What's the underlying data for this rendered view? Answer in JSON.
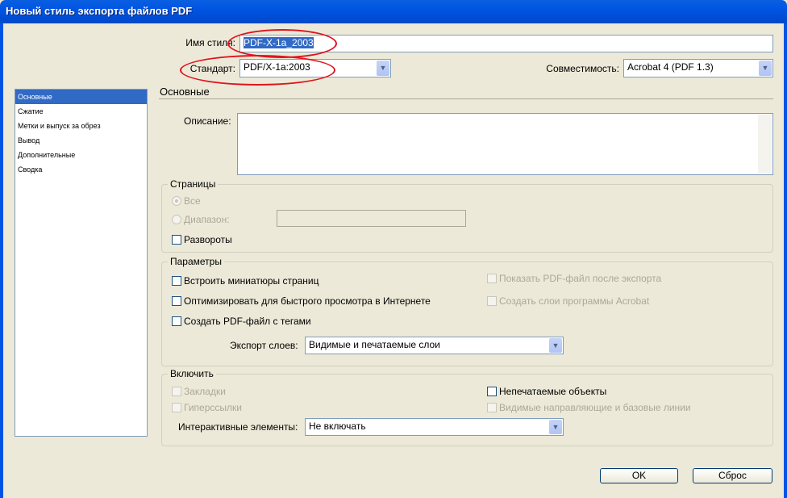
{
  "window": {
    "title": "Новый стиль экспорта файлов PDF"
  },
  "top": {
    "style_name_label": "Имя стиля:",
    "style_name_value": "PDF-X-1a_2003",
    "standard_label": "Стандарт:",
    "standard_value": "PDF/X-1a:2003",
    "compat_label": "Совместимость:",
    "compat_value": "Acrobat 4 (PDF 1.3)"
  },
  "sidebar": {
    "items": [
      {
        "label": "Основные"
      },
      {
        "label": "Сжатие"
      },
      {
        "label": "Метки и выпуск за обрез"
      },
      {
        "label": "Вывод"
      },
      {
        "label": "Дополнительные"
      },
      {
        "label": "Сводка"
      }
    ]
  },
  "section": {
    "title": "Основные",
    "description_label": "Описание:"
  },
  "pages": {
    "title": "Страницы",
    "all": "Все",
    "range": "Диапазон:",
    "spreads": "Развороты"
  },
  "params": {
    "title": "Параметры",
    "thumbs": "Встроить миниатюры страниц",
    "optimize": "Оптимизировать для быстрого просмотра в Интернете",
    "tagged": "Создать PDF-файл с тегами",
    "show_after": "Показать PDF-файл после экспорта",
    "acrobat_layers": "Создать слои программы Acrobat",
    "export_layers_label": "Экспорт слоев:",
    "export_layers_value": "Видимые и печатаемые слои"
  },
  "include": {
    "title": "Включить",
    "bookmarks": "Закладки",
    "hyperlinks": "Гиперссылки",
    "nonprinting": "Непечатаемые объекты",
    "guides": "Видимые направляющие и базовые линии",
    "interactive_label": "Интерактивные элементы:",
    "interactive_value": "Не включать"
  },
  "buttons": {
    "ok": "OK",
    "reset": "Сброс"
  }
}
